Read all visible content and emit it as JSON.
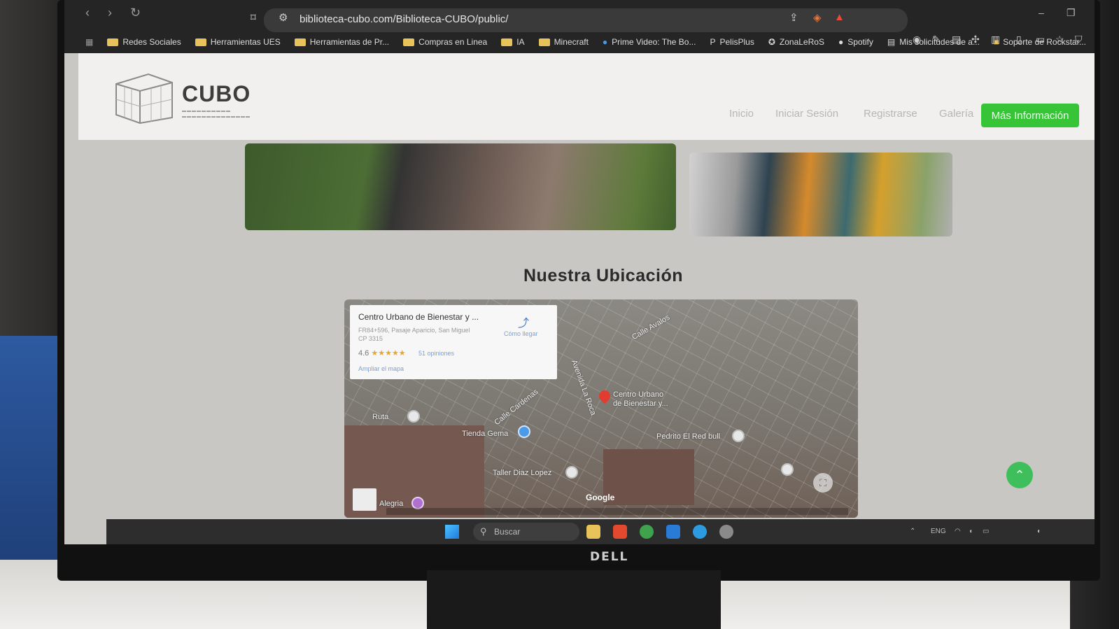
{
  "browser": {
    "url": "biblioteca-cubo.com/Biblioteca-CUBO/public/",
    "bookmarks": [
      "Redes Sociales",
      "Herramientas UES",
      "Herramientas de Pr...",
      "Compras en Linea",
      "IA",
      "Minecraft",
      "Prime Video: The Bo...",
      "PelisPlus",
      "ZonaLeRoS",
      "Spotify",
      "Mis solicitudes de a...",
      "Soporte de Rockstar..."
    ]
  },
  "site": {
    "logo_name": "CUBO",
    "nav": {
      "home": "Inicio",
      "login": "Iniciar Sesión",
      "register": "Registrarse",
      "gallery": "Galería",
      "cta": "Más Información"
    },
    "section_title": "Nuestra Ubicación"
  },
  "map": {
    "card": {
      "title": "Centro Urbano de Bienestar y ...",
      "address": "FR84+596, Pasaje Aparicio, San Miguel CP 3315",
      "rating": "4.6",
      "stars": "★★★★★",
      "reviews": "51 opiniones",
      "expand": "Ampliar el mapa",
      "directions": "Cómo llegar"
    },
    "labels": {
      "calle_avalos": "Calle Avalos",
      "avenida_la_roca": "Avenida La Roca",
      "calle_cardenas": "Calle Cardenas",
      "center_1": "Centro Urbano",
      "center_2": "de Bienestar y...",
      "tienda": "Tienda Gema",
      "ruta": "Ruta",
      "taller": "Taller Diaz Lopez",
      "pedrito": "Pedrito El Red bull",
      "alegria": "Alegria",
      "google": "Google"
    }
  },
  "taskbar": {
    "search_placeholder": "Buscar",
    "lang": "ENG"
  },
  "monitor_brand": "DELL"
}
